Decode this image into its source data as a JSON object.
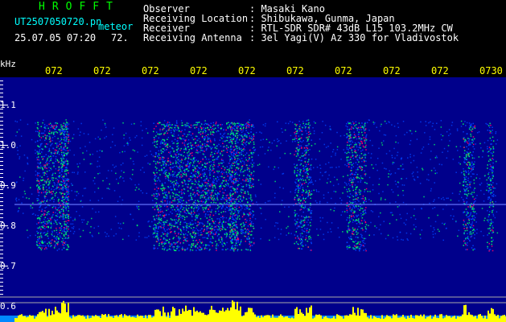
{
  "header": {
    "brand": "HROFFT",
    "filename": "UT2507050720.pn",
    "meteor_label": "meteor",
    "datetime": "25.07.05 07:20",
    "count": "72.",
    "fields": [
      {
        "label": "Observer",
        "value": ": Masaki Kano"
      },
      {
        "label": "Receiving Location",
        "value": ": Shibukawa, Gunma, Japan"
      },
      {
        "label": "Receiver",
        "value": ": RTL-SDR SDR# 43dB L15 103.2MHz CW"
      },
      {
        "label": "Receiving Antenna",
        "value": ": 3el Yagi(V) Az 330 for Vladivostok"
      }
    ]
  },
  "y_axis": {
    "unit": "kHz",
    "ticks": [
      "1.1",
      "1.0",
      "0.9",
      "0.8",
      "0.7",
      "0.6"
    ]
  },
  "time_ticks": [
    "072",
    "072",
    "072",
    "072",
    "072",
    "072",
    "072",
    "072",
    "072",
    "0730"
  ],
  "colors": {
    "background": "#000000",
    "spectrogram_bg": "#00008b",
    "header_text": "#00ffff",
    "title_text": "#00ff00",
    "tick_text": "#ffff00",
    "signal_low": "#0044ff",
    "signal_mid": "#00ff66",
    "signal_high": "#ff0066",
    "amplitude_bar": "#ffff00"
  }
}
